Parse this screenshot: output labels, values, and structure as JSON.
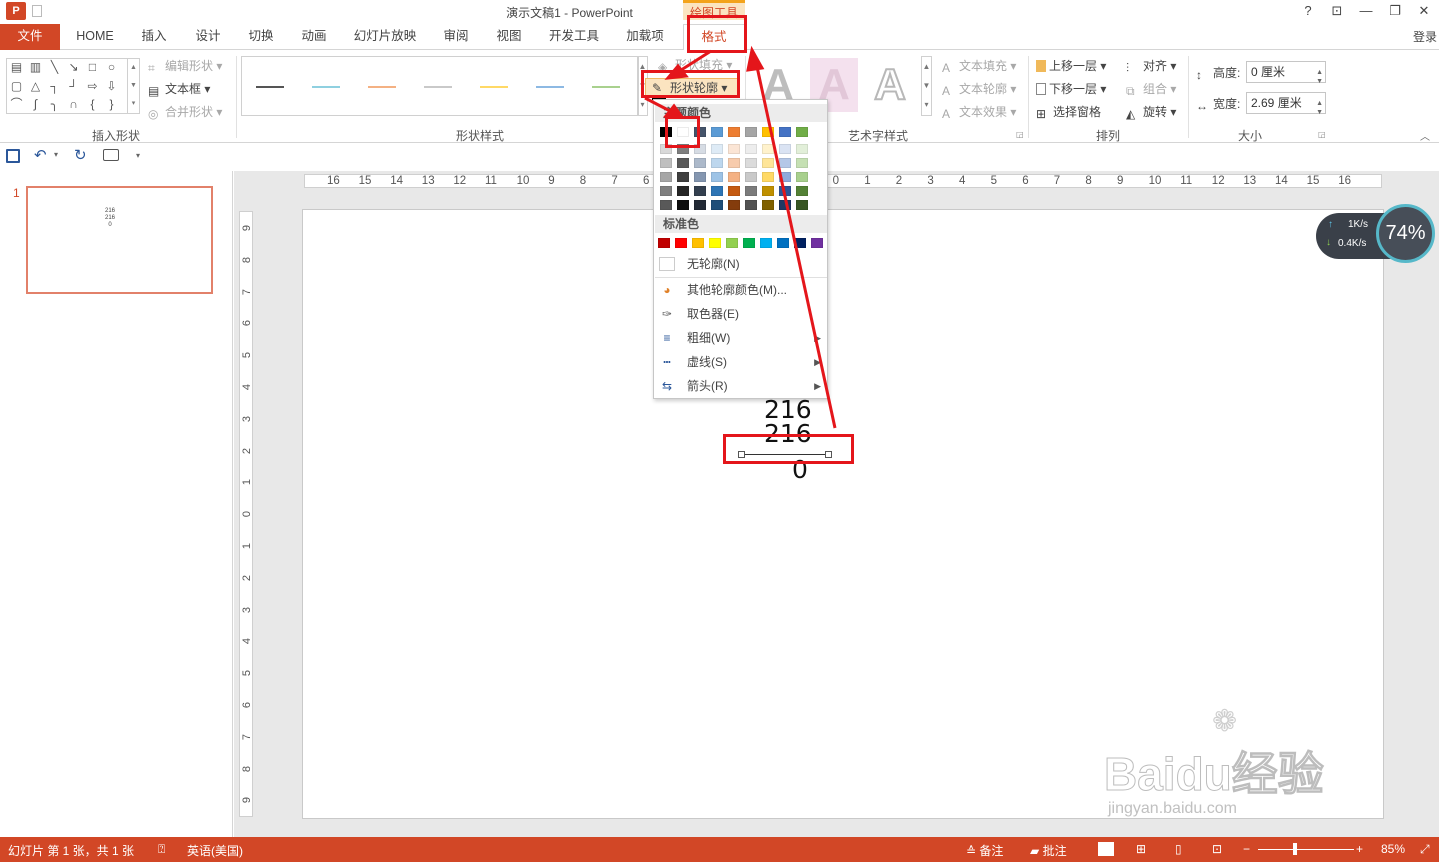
{
  "titlebar": {
    "app_logo": "P",
    "doc_title": "演示文稿1 - PowerPoint",
    "context_tab_label": "绘图工具",
    "help": "?",
    "ribbon_display": "⊡",
    "minimize": "—",
    "restore": "❐",
    "close": "✕"
  },
  "tabs": {
    "file": "文件",
    "home": "HOME",
    "insert": "插入",
    "design": "设计",
    "transitions": "切换",
    "animations": "动画",
    "slideshow": "幻灯片放映",
    "review": "审阅",
    "view": "视图",
    "developer": "开发工具",
    "addins": "加载项",
    "format": "格式",
    "login": "登录"
  },
  "ribbon": {
    "edit_shape": "编辑形状",
    "textbox": "文本框",
    "merge_shapes": "合并形状",
    "group_insert_shapes": "插入形状",
    "group_shape_styles": "形状样式",
    "shape_fill": "形状填充",
    "shape_outline": "形状轮廓",
    "group_wordart": "艺术字样式",
    "text_fill": "文本填充",
    "text_outline": "文本轮廓",
    "text_effects": "文本效果",
    "bring_forward": "上移一层",
    "send_backward": "下移一层",
    "selection_pane": "选择窗格",
    "align": "对齐",
    "group": "组合",
    "rotate": "旋转",
    "group_arrange": "排列",
    "height_label": "高度:",
    "height_value": "0 厘米",
    "width_label": "宽度:",
    "width_value": "2.69 厘米",
    "group_size": "大小",
    "wordart_letter": "A",
    "line_colors": [
      "#555555",
      "#8fd0e0",
      "#f4b183",
      "#c9c9c9",
      "#ffd966",
      "#8db9e3",
      "#a9d18e"
    ]
  },
  "thumbnail": {
    "slide_number": "1"
  },
  "ruler": {
    "h": [
      "16",
      "15",
      "14",
      "13",
      "12",
      "11",
      "10",
      "9",
      "8",
      "7",
      "6",
      "5",
      "4",
      "3",
      "2",
      "1",
      "0",
      "1",
      "2",
      "3",
      "4",
      "5",
      "6",
      "7",
      "8",
      "9",
      "10",
      "11",
      "12",
      "13",
      "14",
      "15",
      "16"
    ],
    "v": [
      "9",
      "8",
      "7",
      "6",
      "5",
      "4",
      "3",
      "2",
      "1",
      "0",
      "1",
      "2",
      "3",
      "4",
      "5",
      "6",
      "7",
      "8",
      "9"
    ]
  },
  "slide_text": {
    "line1": "216",
    "line2": "216",
    "line3": "0"
  },
  "dropdown": {
    "theme_colors_label": "主题颜色",
    "standard_colors_label": "标准色",
    "theme_top": [
      "#000000",
      "#ffffff",
      "#44546a",
      "#5b9bd5",
      "#ed7d31",
      "#a5a5a5",
      "#ffc000",
      "#4472c4",
      "#70ad47"
    ],
    "theme_columns": [
      [
        "#d9d9d9",
        "#bfbfbf",
        "#a6a6a6",
        "#7f7f7f",
        "#595959"
      ],
      [
        "#7f7f7f",
        "#595959",
        "#3f3f3f",
        "#262626",
        "#0d0d0d"
      ],
      [
        "#d6dce4",
        "#acb9ca",
        "#8496b0",
        "#333f4f",
        "#222a35"
      ],
      [
        "#deebf6",
        "#bdd7ee",
        "#9dc3e6",
        "#2e75b5",
        "#1f4e79"
      ],
      [
        "#fbe5d5",
        "#f7cbac",
        "#f4b183",
        "#c55a11",
        "#843c0c"
      ],
      [
        "#ededed",
        "#dbdbdb",
        "#c9c9c9",
        "#7b7b7b",
        "#525252"
      ],
      [
        "#fff2cc",
        "#fee599",
        "#ffd965",
        "#bf9000",
        "#7f6000"
      ],
      [
        "#dae3f3",
        "#b4c7e7",
        "#8faadc",
        "#2f5496",
        "#1f3864"
      ],
      [
        "#e2efd9",
        "#c5e0b3",
        "#a8d08d",
        "#538135",
        "#375623"
      ]
    ],
    "standard": [
      "#c00000",
      "#ff0000",
      "#ffc000",
      "#ffff00",
      "#92d050",
      "#00b050",
      "#00b0f0",
      "#0070c0",
      "#002060",
      "#7030a0"
    ],
    "no_outline": "无轮廓(N)",
    "more_colors": "其他轮廓颜色(M)...",
    "eyedropper": "取色器(E)",
    "weight": "粗细(W)",
    "dashes": "虚线(S)",
    "arrows": "箭头(R)"
  },
  "speed_widget": {
    "up": "1K/s",
    "down": "0.4K/s",
    "percent": "74%"
  },
  "statusbar": {
    "slide_info": "幻灯片 第 1 张，共 1 张",
    "language": "英语(美国)",
    "notes": "备注",
    "comments": "批注",
    "zoom": "85%"
  },
  "watermark": {
    "brand": "Baidu经验",
    "url": "jingyan.baidu.com"
  },
  "colors": {
    "accent": "#d24726",
    "annotation": "#e4161b"
  }
}
